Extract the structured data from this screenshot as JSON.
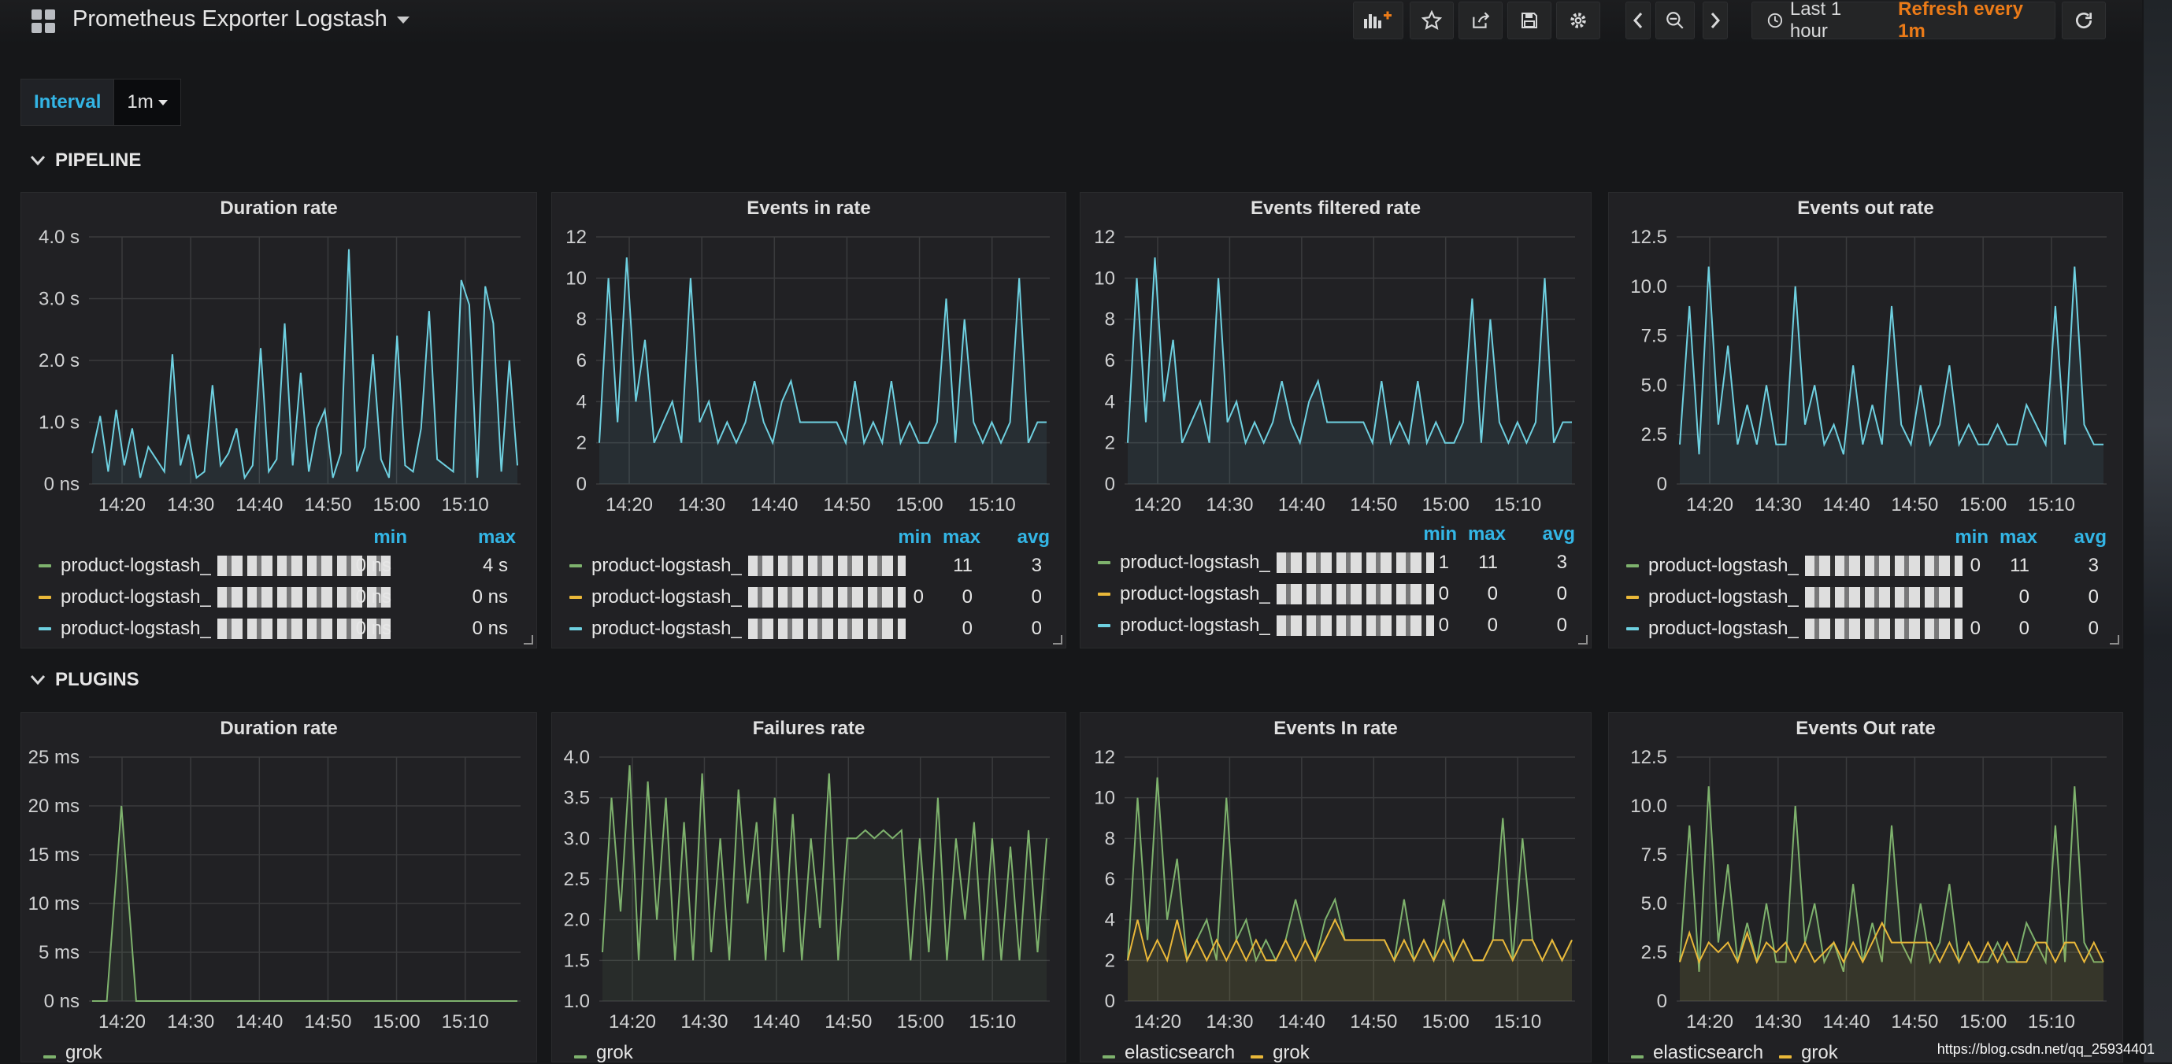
{
  "nav": {
    "title": "Prometheus Exporter Logstash",
    "time_range": "Last 1 hour",
    "refresh": "Refresh every 1m"
  },
  "variables": {
    "interval_label": "Interval",
    "interval_value": "1m"
  },
  "rows": [
    {
      "title": "PIPELINE"
    },
    {
      "title": "PLUGINS"
    }
  ],
  "colors": {
    "green": "#7eb26d",
    "yellow": "#eab839",
    "blue": "#6ed0e0",
    "teal": "#7eb26d",
    "accent": "#33b5e5",
    "orange": "#eb7b18"
  },
  "x_ticks": [
    "14:20",
    "14:30",
    "14:40",
    "14:50",
    "15:00",
    "15:10"
  ],
  "panels": [
    {
      "title": "Duration rate",
      "y_ticks": [
        "4.0 s",
        "3.0 s",
        "2.0 s",
        "1.0 s",
        "0 ns"
      ],
      "legend_headers": [
        "min",
        "max"
      ],
      "legend": [
        {
          "name": "product-logstash_",
          "color": "green",
          "values": [
            "0 ns",
            "4 s"
          ]
        },
        {
          "name": "product-logstash_",
          "color": "yellow",
          "values": [
            "0 ns",
            "0 ns"
          ]
        },
        {
          "name": "product-logstash_",
          "color": "blue",
          "values": [
            "0 ns",
            "0 ns"
          ]
        }
      ]
    },
    {
      "title": "Events in rate",
      "y_ticks": [
        "12",
        "10",
        "8",
        "6",
        "4",
        "2",
        "0"
      ],
      "legend_headers": [
        "min",
        "max",
        "avg"
      ],
      "legend": [
        {
          "name": "product-logstash_",
          "color": "green",
          "values": [
            "",
            "11",
            "3"
          ]
        },
        {
          "name": "product-logstash_",
          "color": "yellow",
          "values": [
            "0",
            "0",
            "0"
          ]
        },
        {
          "name": "product-logstash_",
          "color": "blue",
          "values": [
            "",
            "0",
            "0"
          ]
        }
      ]
    },
    {
      "title": "Events filtered rate",
      "y_ticks": [
        "12",
        "10",
        "8",
        "6",
        "4",
        "2",
        "0"
      ],
      "legend_headers": [
        "min",
        "max",
        "avg"
      ],
      "legend": [
        {
          "name": "product-logstash_",
          "color": "green",
          "values": [
            "1",
            "11",
            "3"
          ]
        },
        {
          "name": "product-logstash_",
          "color": "yellow",
          "values": [
            "0",
            "0",
            "0"
          ]
        },
        {
          "name": "product-logstash_",
          "color": "blue",
          "values": [
            "0",
            "0",
            "0"
          ]
        }
      ]
    },
    {
      "title": "Events out rate",
      "y_ticks": [
        "12.5",
        "10.0",
        "7.5",
        "5.0",
        "2.5",
        "0"
      ],
      "legend_headers": [
        "min",
        "max",
        "avg"
      ],
      "legend": [
        {
          "name": "product-logstash_",
          "color": "green",
          "values": [
            "0",
            "11",
            "3"
          ]
        },
        {
          "name": "product-logstash_",
          "color": "yellow",
          "values": [
            "",
            "0",
            "0"
          ]
        },
        {
          "name": "product-logstash_",
          "color": "blue",
          "values": [
            "0",
            "0",
            "0"
          ]
        }
      ]
    },
    {
      "title": "Duration rate",
      "y_ticks": [
        "25 ms",
        "20 ms",
        "15 ms",
        "10 ms",
        "5 ms",
        "0 ns"
      ],
      "bottom_legend": [
        {
          "name": "grok",
          "color": "green"
        }
      ]
    },
    {
      "title": "Failures rate",
      "y_ticks": [
        "4.0",
        "3.5",
        "3.0",
        "2.5",
        "2.0",
        "1.5",
        "1.0"
      ],
      "bottom_legend": [
        {
          "name": "grok",
          "color": "green"
        }
      ]
    },
    {
      "title": "Events In rate",
      "y_ticks": [
        "12",
        "10",
        "8",
        "6",
        "4",
        "2",
        "0"
      ],
      "bottom_legend": [
        {
          "name": "elasticsearch",
          "color": "green"
        },
        {
          "name": "grok",
          "color": "yellow"
        }
      ]
    },
    {
      "title": "Events Out rate",
      "y_ticks": [
        "12.5",
        "10.0",
        "7.5",
        "5.0",
        "2.5",
        "0"
      ],
      "bottom_legend": [
        {
          "name": "elasticsearch",
          "color": "green"
        },
        {
          "name": "grok",
          "color": "yellow"
        }
      ]
    }
  ],
  "chart_data": [
    {
      "type": "line",
      "title": "Duration rate",
      "series": [
        {
          "name": "product-logstash_",
          "values": [
            0.5,
            1.1,
            0.2,
            1.2,
            0.3,
            0.9,
            0.1,
            0.6,
            0.4,
            0.2,
            2.1,
            0.3,
            0.8,
            0.1,
            0.2,
            1.6,
            0.3,
            0.5,
            0.9,
            0.1,
            0.3,
            2.2,
            0.2,
            0.4,
            2.6,
            0.3,
            1.8,
            0.2,
            0.9,
            1.2,
            0.1,
            0.5,
            3.8,
            0.2,
            0.6,
            2.1,
            0.4,
            0.1,
            2.4,
            0.3,
            0.2,
            0.9,
            2.8,
            0.4,
            0.3,
            0.2,
            3.3,
            2.9,
            0.1,
            3.2,
            2.6,
            0.2,
            2.0,
            0.3
          ]
        }
      ]
    },
    {
      "type": "line",
      "title": "Events in rate",
      "series": [
        {
          "name": "product-logstash_",
          "values": [
            2,
            10,
            3,
            11,
            4,
            7,
            2,
            3,
            4,
            2,
            10,
            3,
            4,
            2,
            3,
            2,
            3,
            5,
            3,
            2,
            4,
            5,
            3,
            3,
            3,
            3,
            3,
            2,
            5,
            2,
            3,
            2,
            5,
            2,
            3,
            2,
            2,
            3,
            9,
            2,
            8,
            3,
            2,
            3,
            2,
            3,
            10,
            2,
            3,
            3
          ]
        }
      ]
    },
    {
      "type": "line",
      "title": "Events filtered rate",
      "series": [
        {
          "name": "product-logstash_",
          "values": [
            2,
            10,
            3,
            11,
            4,
            7,
            2,
            3,
            4,
            2,
            10,
            3,
            4,
            2,
            3,
            2,
            3,
            5,
            3,
            2,
            4,
            5,
            3,
            3,
            3,
            3,
            3,
            2,
            5,
            2,
            3,
            2,
            5,
            2,
            3,
            2,
            2,
            3,
            9,
            2,
            8,
            3,
            2,
            3,
            2,
            3,
            10,
            2,
            3,
            3
          ]
        }
      ]
    },
    {
      "type": "line",
      "title": "Events out rate",
      "series": [
        {
          "name": "product-logstash_",
          "values": [
            2,
            9,
            1.5,
            11,
            3,
            7,
            2,
            4,
            2,
            5,
            2,
            2,
            10,
            3,
            5,
            2,
            3,
            1.5,
            6,
            2,
            4,
            2,
            9,
            3,
            2,
            5,
            2,
            3,
            6,
            2,
            3,
            2,
            2,
            3,
            2,
            2,
            4,
            3,
            2,
            9,
            2,
            11,
            3,
            2,
            2
          ]
        }
      ]
    },
    {
      "type": "line",
      "title": "Duration rate",
      "series": [
        {
          "name": "grok",
          "values": [
            0,
            0,
            20,
            0,
            0,
            0,
            0,
            0,
            0,
            0,
            0,
            0,
            0,
            0,
            0,
            0,
            0,
            0,
            0,
            0,
            0,
            0,
            0,
            0,
            0,
            0,
            0,
            0,
            0,
            0
          ]
        }
      ]
    },
    {
      "type": "line",
      "title": "Failures rate",
      "series": [
        {
          "name": "grok",
          "values": [
            1.6,
            3.5,
            2.1,
            3.9,
            1.5,
            3.7,
            2.0,
            3.5,
            1.5,
            3.2,
            1.5,
            3.8,
            1.6,
            3.0,
            1.5,
            3.6,
            2.2,
            3.2,
            1.5,
            3.5,
            1.6,
            3.3,
            1.5,
            3.0,
            1.9,
            3.8,
            1.5,
            3.0,
            3.0,
            3.1,
            3.0,
            3.1,
            3.0,
            3.1,
            1.5,
            3.0,
            1.6,
            3.5,
            1.5,
            3.0,
            2.0,
            3.2,
            1.5,
            3.0,
            1.5,
            2.9,
            1.5,
            3.1,
            1.6,
            3.0
          ]
        }
      ]
    },
    {
      "type": "line",
      "title": "Events In rate",
      "series": [
        {
          "name": "elasticsearch",
          "values": [
            2,
            10,
            3,
            11,
            4,
            7,
            2,
            3,
            4,
            2,
            10,
            3,
            4,
            2,
            3,
            2,
            3,
            5,
            3,
            2,
            4,
            5,
            3,
            3,
            3,
            3,
            3,
            2,
            5,
            2,
            3,
            2,
            5,
            2,
            3,
            2,
            2,
            3,
            9,
            2,
            8,
            3,
            2,
            3,
            2,
            3
          ]
        },
        {
          "name": "grok",
          "values": [
            2,
            4,
            2,
            3,
            2,
            4,
            2,
            3,
            2,
            3,
            2,
            3,
            2,
            3,
            2,
            2,
            3,
            2,
            3,
            2,
            3,
            4,
            3,
            3,
            3,
            3,
            3,
            2,
            3,
            2,
            3,
            2,
            3,
            2,
            3,
            2,
            2,
            3,
            3,
            2,
            3,
            3,
            2,
            3,
            2,
            3
          ]
        }
      ]
    },
    {
      "type": "line",
      "title": "Events Out rate",
      "series": [
        {
          "name": "elasticsearch",
          "values": [
            2,
            9,
            1.5,
            11,
            3,
            7,
            2,
            4,
            2,
            5,
            2,
            2,
            10,
            3,
            5,
            2,
            3,
            1.5,
            6,
            2,
            4,
            2,
            9,
            3,
            2,
            5,
            2,
            3,
            6,
            2,
            3,
            2,
            2,
            3,
            2,
            2,
            4,
            3,
            2,
            9,
            2,
            11,
            3,
            2,
            2
          ]
        },
        {
          "name": "grok",
          "values": [
            2,
            3.5,
            2,
            3,
            2.5,
            3,
            2,
            3.5,
            2,
            3,
            2.5,
            3,
            2,
            3,
            2,
            2.5,
            3,
            2,
            3,
            2,
            3,
            4,
            3,
            3,
            3,
            3,
            3,
            2,
            3,
            2,
            3,
            2,
            3,
            2,
            3,
            2,
            2,
            3,
            3,
            2,
            3,
            3,
            2,
            3,
            2
          ]
        }
      ]
    }
  ],
  "watermark": "https://blog.csdn.net/qq_25934401"
}
